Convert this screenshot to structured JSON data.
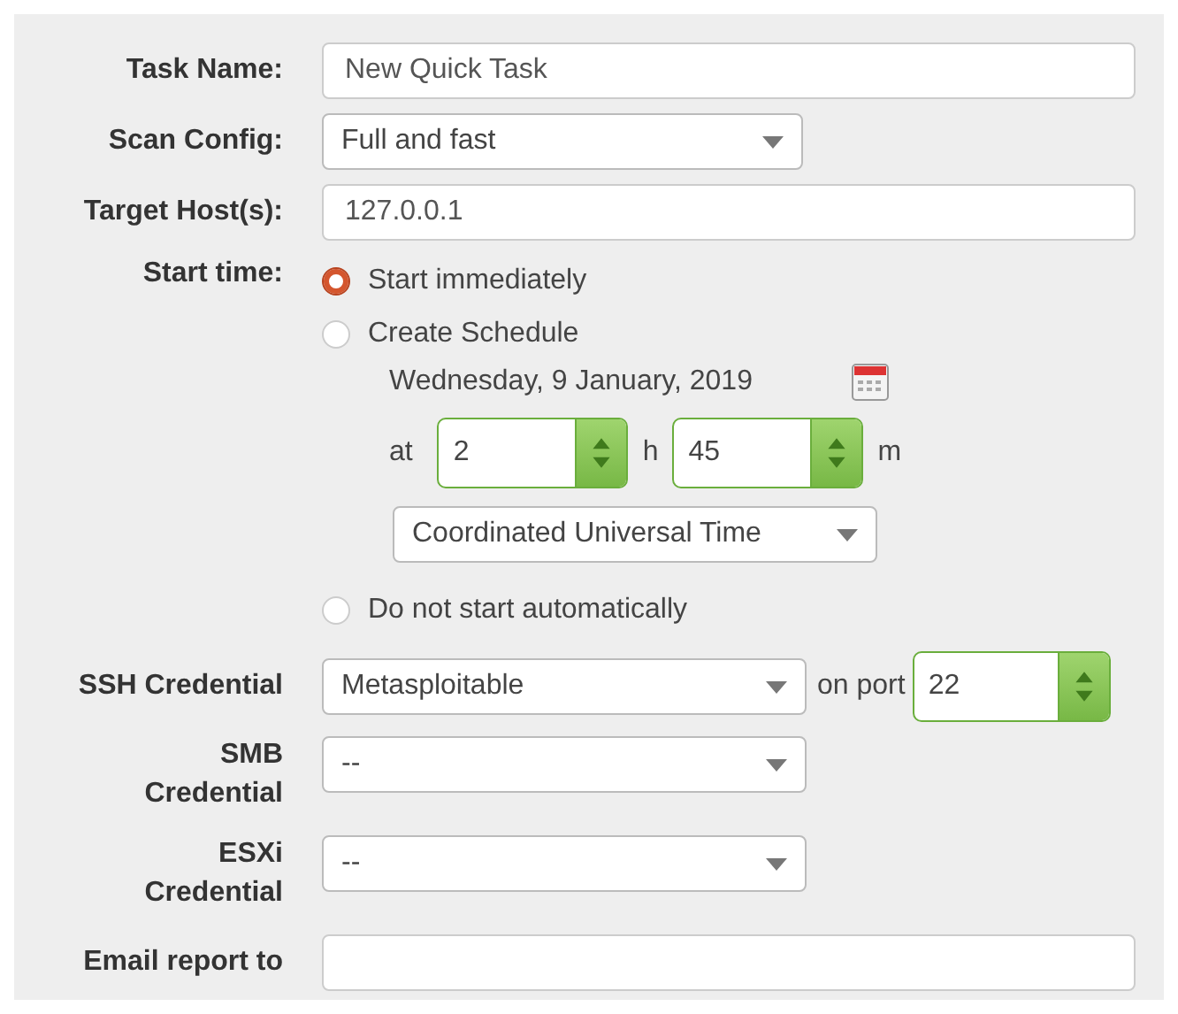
{
  "task_name": {
    "label": "Task Name:",
    "value": "New Quick Task"
  },
  "scan_config": {
    "label": "Scan Config:",
    "value": "Full and fast"
  },
  "target_hosts": {
    "label": "Target Host(s):",
    "value": "127.0.0.1"
  },
  "start_time": {
    "label": "Start time:",
    "options": [
      {
        "label": "Start immediately",
        "selected": true,
        "kind": "plain"
      },
      {
        "label": "Create Schedule",
        "selected": false,
        "kind": "schedule"
      },
      {
        "label": "Do not start automatically",
        "selected": false,
        "kind": "plain"
      }
    ],
    "schedule": {
      "date": "Wednesday, 9 January, 2019",
      "at_label": "at",
      "hour": "2",
      "hour_unit": "h",
      "minute": "45",
      "minute_unit": "m",
      "timezone": "Coordinated Universal Time"
    }
  },
  "ssh_credential": {
    "label": "SSH Credential",
    "value": "Metasploitable",
    "port_label": "on port",
    "port": "22"
  },
  "smb_credential": {
    "label_lines": [
      "SMB",
      "Credential"
    ],
    "value": "--"
  },
  "esxi_credential": {
    "label_lines": [
      "ESXi",
      "Credential"
    ],
    "value": "--"
  },
  "email_report": {
    "label": "Email report to"
  }
}
